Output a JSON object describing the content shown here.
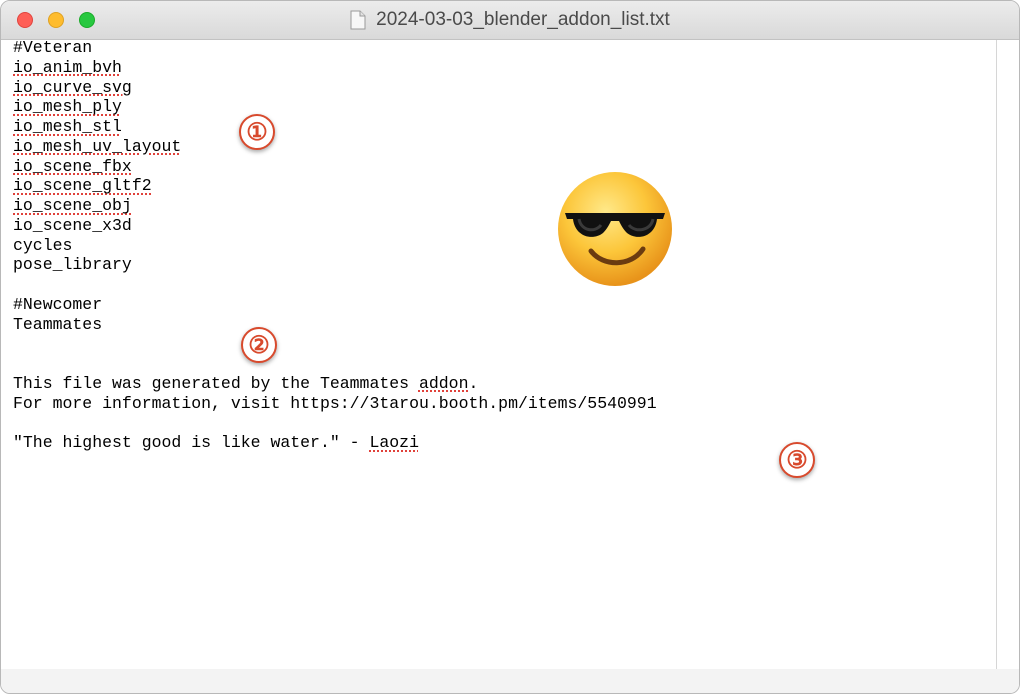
{
  "window": {
    "title": "2024-03-03_blender_addon_list.txt",
    "controls": [
      "close",
      "minimize",
      "zoom"
    ]
  },
  "icons": {
    "document": "document-icon",
    "emoji": "smiling-face-with-sunglasses-emoji"
  },
  "editor": {
    "lines": [
      "#Veteran",
      "io_anim_bvh",
      "io_curve_svg",
      "io_mesh_ply",
      "io_mesh_stl",
      "io_mesh_uv_layout",
      "io_scene_fbx",
      "io_scene_gltf2",
      "io_scene_obj",
      "io_scene_x3d",
      "cycles",
      "pose_library",
      "",
      "#Newcomer",
      "Teammates",
      "",
      "",
      "This file was generated by the Teammates addon.",
      "For more information, visit https://3tarou.booth.pm/items/5540991",
      "",
      "\"The highest good is like water.\" - Laozi"
    ]
  },
  "spellcheck": {
    "lines": [
      1,
      2,
      3,
      4,
      5,
      6,
      7,
      8
    ],
    "words": [
      {
        "line": 17,
        "before": "This file was generated by the Teammates ",
        "word": "addon",
        "after": "."
      },
      {
        "line": 20,
        "before": "\"The highest good is like water.\" - ",
        "word": "Laozi",
        "after": ""
      }
    ]
  },
  "markers": [
    "①",
    "②",
    "③"
  ],
  "colors": {
    "marker": "#d84a2d",
    "spellcheck_underline": "#e0413a",
    "close": "#fe5f57",
    "minimize": "#febc2e",
    "zoom": "#28c840"
  }
}
